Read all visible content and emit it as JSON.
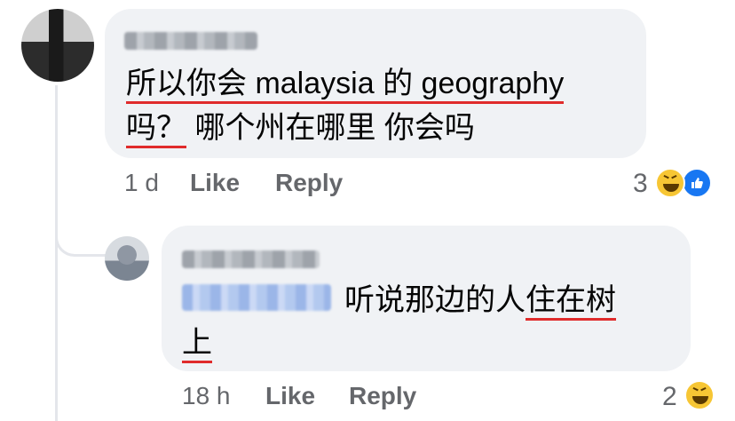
{
  "comment": {
    "text_line1_a": "所以你会",
    "text_line1_b": "malaysia",
    "text_line1_c": "的",
    "text_line1_d": "geography",
    "text_line2_a": "吗？",
    "text_line2_b": "哪个州在哪里 你会吗",
    "time": "1 d",
    "like_label": "Like",
    "reply_label": "Reply",
    "reaction_count": "3",
    "reactions": [
      "haha-icon",
      "like-icon"
    ]
  },
  "reply": {
    "text_line1_a": "听说那边的人",
    "text_line1_b": "住在树",
    "text_line2": "上",
    "time": "18 h",
    "like_label": "Like",
    "reply_label": "Reply",
    "reaction_count": "2",
    "reactions": [
      "haha-icon"
    ]
  },
  "colors": {
    "bubble": "#f0f2f5",
    "underline": "#e02b2b",
    "meta_text": "#65676b",
    "like_blue": "#1877f2"
  }
}
